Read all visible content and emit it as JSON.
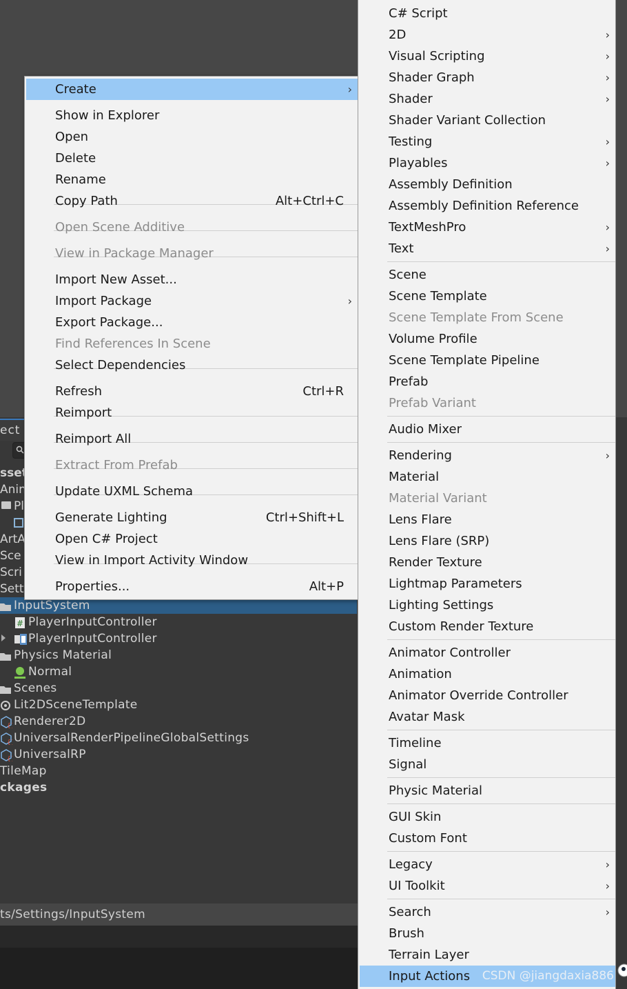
{
  "context_menu": {
    "items": [
      {
        "label": "Create",
        "highlight": true,
        "submenu": true
      },
      {
        "label": "Show in Explorer"
      },
      {
        "label": "Open"
      },
      {
        "label": "Delete"
      },
      {
        "label": "Rename"
      },
      {
        "label": "Copy Path",
        "shortcut": "Alt+Ctrl+C"
      },
      {
        "label": "Open Scene Additive",
        "disabled": true
      },
      {
        "label": "View in Package Manager",
        "disabled": true
      },
      {
        "label": "Import New Asset..."
      },
      {
        "label": "Import Package",
        "submenu": true
      },
      {
        "label": "Export Package..."
      },
      {
        "label": "Find References In Scene",
        "disabled": true
      },
      {
        "label": "Select Dependencies"
      },
      {
        "label": "Refresh",
        "shortcut": "Ctrl+R"
      },
      {
        "label": "Reimport"
      },
      {
        "label": "Reimport All"
      },
      {
        "label": "Extract From Prefab",
        "disabled": true
      },
      {
        "label": "Update UXML Schema"
      },
      {
        "label": "Generate Lighting",
        "shortcut": "Ctrl+Shift+L"
      },
      {
        "label": "Open C# Project"
      },
      {
        "label": "View in Import Activity Window"
      },
      {
        "label": "Properties...",
        "shortcut": "Alt+P"
      }
    ]
  },
  "create_submenu": {
    "items": [
      {
        "label": "C# Script"
      },
      {
        "label": "2D",
        "submenu": true
      },
      {
        "label": "Visual Scripting",
        "submenu": true
      },
      {
        "label": "Shader Graph",
        "submenu": true
      },
      {
        "label": "Shader",
        "submenu": true
      },
      {
        "label": "Shader Variant Collection"
      },
      {
        "label": "Testing",
        "submenu": true
      },
      {
        "label": "Playables",
        "submenu": true
      },
      {
        "label": "Assembly Definition"
      },
      {
        "label": "Assembly Definition Reference"
      },
      {
        "label": "TextMeshPro",
        "submenu": true
      },
      {
        "label": "Text",
        "submenu": true
      },
      {
        "label": "Scene"
      },
      {
        "label": "Scene Template"
      },
      {
        "label": "Scene Template From Scene",
        "disabled": true
      },
      {
        "label": "Volume Profile"
      },
      {
        "label": "Scene Template Pipeline"
      },
      {
        "label": "Prefab"
      },
      {
        "label": "Prefab Variant",
        "disabled": true
      },
      {
        "label": "Audio Mixer"
      },
      {
        "label": "Rendering",
        "submenu": true
      },
      {
        "label": "Material"
      },
      {
        "label": "Material Variant",
        "disabled": true
      },
      {
        "label": "Lens Flare"
      },
      {
        "label": "Lens Flare (SRP)"
      },
      {
        "label": "Render Texture"
      },
      {
        "label": "Lightmap Parameters"
      },
      {
        "label": "Lighting Settings"
      },
      {
        "label": "Custom Render Texture"
      },
      {
        "label": "Animator Controller"
      },
      {
        "label": "Animation"
      },
      {
        "label": "Animator Override Controller"
      },
      {
        "label": "Avatar Mask"
      },
      {
        "label": "Timeline"
      },
      {
        "label": "Signal"
      },
      {
        "label": "Physic Material"
      },
      {
        "label": "GUI Skin"
      },
      {
        "label": "Custom Font"
      },
      {
        "label": "Legacy",
        "submenu": true
      },
      {
        "label": "UI Toolkit",
        "submenu": true
      },
      {
        "label": "Search",
        "submenu": true
      },
      {
        "label": "Brush"
      },
      {
        "label": "Terrain Layer"
      },
      {
        "label": "Input Actions",
        "highlight": true
      }
    ]
  },
  "watermark": "CSDN @jiangdaxia886",
  "project_panel": {
    "tab_label": "ect",
    "left_items": [
      "sset",
      "Anin",
      "Pl",
      "ArtA",
      "Sce",
      "Scri",
      "Sett"
    ],
    "tree": [
      {
        "label": "InputSystem",
        "icon": "folder-open-icon",
        "selected": true
      },
      {
        "label": "PlayerInputController",
        "icon": "script-icon"
      },
      {
        "label": "PlayerInputController",
        "icon": "input-actions-icon"
      },
      {
        "label": "Physics Material",
        "icon": "folder-icon"
      },
      {
        "label": "Normal",
        "icon": "physic-material-icon"
      },
      {
        "label": "Scenes",
        "icon": "folder-icon"
      },
      {
        "label": "Lit2DSceneTemplate",
        "icon": "scene-template-icon"
      },
      {
        "label": "Renderer2D",
        "icon": "render-asset-icon"
      },
      {
        "label": "UniversalRenderPipelineGlobalSettings",
        "icon": "render-asset-icon"
      },
      {
        "label": "UniversalRP",
        "icon": "render-asset-icon"
      },
      {
        "label": "TileMap",
        "icon": "none"
      },
      {
        "label": "ckages",
        "icon": "none",
        "bold": true
      }
    ],
    "path": "ts/Settings/InputSystem"
  }
}
